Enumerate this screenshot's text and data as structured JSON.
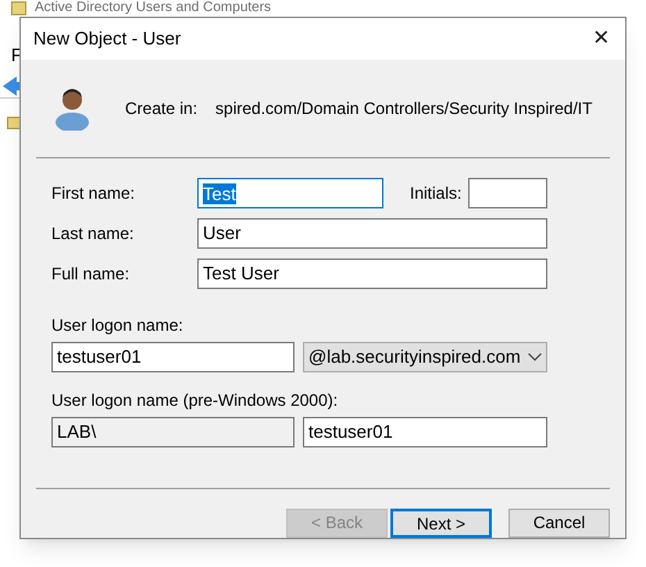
{
  "background_window": {
    "title": "Active Directory Users and Computers",
    "menu_letter": "F"
  },
  "dialog": {
    "title": "New Object - User",
    "close": "✕",
    "create_in_label": "Create in:",
    "create_in_path": "spired.com/Domain Controllers/Security Inspired/IT"
  },
  "fields": {
    "first_name": {
      "label": "First name:",
      "value": "Test",
      "focused": true
    },
    "initials": {
      "label": "Initials:"
    },
    "last_name": {
      "label": "Last name:",
      "value": "User"
    },
    "full_name": {
      "label": "Full name:",
      "value": "Test User"
    },
    "logon_name": {
      "label": "User logon name:",
      "value": "testuser01",
      "domain": "@lab.securityinspired.com"
    },
    "pre2000": {
      "label": "User logon name (pre-Windows 2000):",
      "prefix": "LAB\\",
      "value": "testuser01"
    }
  },
  "buttons": [
    {
      "label": "< Back",
      "disabled": true,
      "default": false
    },
    {
      "label": "Next >",
      "disabled": false,
      "default": true
    },
    {
      "label": "Cancel",
      "disabled": false,
      "default": false
    }
  ]
}
